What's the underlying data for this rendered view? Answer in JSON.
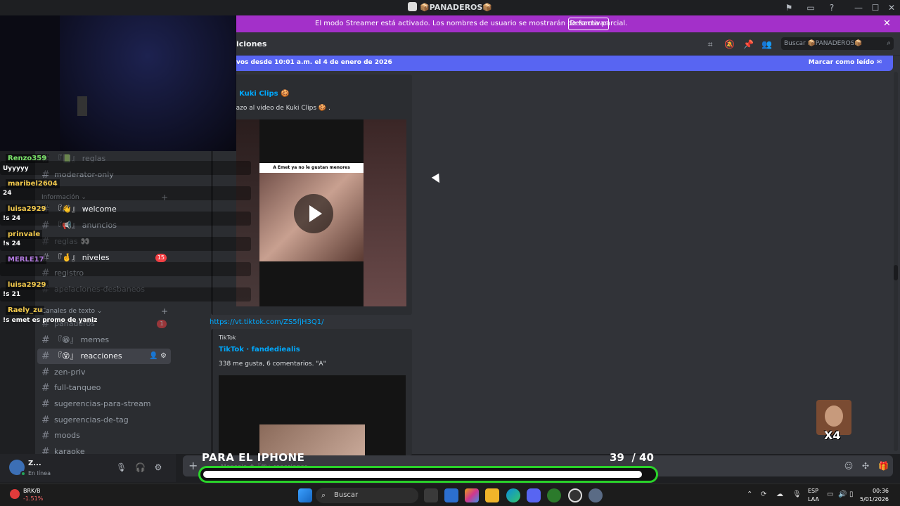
{
  "titlebar": {
    "title": "📦PANADEROS📦"
  },
  "banner": {
    "text": "El modo Streamer está activado. Los nombres de usuario se mostrarán de forma parcial.",
    "button": "Desactivar"
  },
  "header": {
    "channel": "iciones",
    "search_placeholder": "Buscar 📦PANADEROS📦"
  },
  "new_messages": {
    "text": "vos desde 10:01 a.m. el 4 de enero de 2026",
    "mark_read": "Marcar como leído"
  },
  "sidebar": {
    "channels": [
      {
        "label": "reglas",
        "prefix": "『📗』",
        "state": "muted"
      },
      {
        "label": "moderator-only",
        "prefix": "",
        "state": "normal"
      },
      {
        "label": "welcome",
        "prefix": "『👋』",
        "state": "unread"
      },
      {
        "label": "anuncios",
        "prefix": "『📢』",
        "state": "normal"
      },
      {
        "label": "reglas 👀",
        "prefix": "",
        "state": "muted"
      },
      {
        "label": "niveles",
        "prefix": "『🤞』",
        "state": "unread",
        "badge": "15"
      },
      {
        "label": "registro",
        "prefix": "",
        "state": "normal"
      },
      {
        "label": "apelaciones-desbaneos",
        "prefix": "",
        "state": "muted"
      },
      {
        "label": "panaderos",
        "prefix": "",
        "state": "muted",
        "badge": "1"
      },
      {
        "label": "memes",
        "prefix": "『😁』",
        "state": "normal"
      },
      {
        "label": "reacciones",
        "prefix": "『😵』",
        "state": "active"
      },
      {
        "label": "zen-priv",
        "prefix": "",
        "state": "normal"
      },
      {
        "label": "full-tanqueo",
        "prefix": "",
        "state": "normal"
      },
      {
        "label": "sugerencias-para-stream",
        "prefix": "",
        "state": "normal"
      },
      {
        "label": "sugerencias-de-tag",
        "prefix": "",
        "state": "normal"
      },
      {
        "label": "moods",
        "prefix": "",
        "state": "normal"
      },
      {
        "label": "karaoke",
        "prefix": "",
        "state": "normal"
      }
    ],
    "categories": {
      "info": "Información",
      "text": "Canales de texto"
    }
  },
  "user": {
    "name": "Z...",
    "status": "En línea"
  },
  "messages": {
    "embed1": {
      "title": "tok · Kuki Clips 🍪",
      "desc": "n vistazo al video de Kuki Clips 🍪 .",
      "thumb_caption": "A Emet ya no le gustan menores"
    },
    "link": "https://vt.tiktok.com/ZS5fjH3Q1/",
    "embed2": {
      "provider": "TikTok",
      "title": "TikTok · fandediealis",
      "desc": "338 me gusta, 6 comentarios. \"A\""
    }
  },
  "composer": {
    "placeholder": "Mensaje #『😵』reacciones"
  },
  "overlay": {
    "chat": [
      {
        "user": "Renzo359",
        "msg": "Uyyyyy",
        "color": "#7be36a"
      },
      {
        "user": "maribel2604",
        "msg": "24",
        "color": "#f2c94c"
      },
      {
        "user": "luisa2929",
        "msg": "!s 24",
        "color": "#f2c94c"
      },
      {
        "user": "prinvale",
        "msg": "!s 24",
        "color": "#f2c94c"
      },
      {
        "user": "MERLE17",
        "msg": "",
        "color": "#b57be3"
      },
      {
        "user": "luisa2929",
        "msg": "!s 21",
        "color": "#f2c94c"
      },
      {
        "user": "Raely_zu",
        "msg": "!s emet es promo de yaniz",
        "color": "#f2c94c"
      }
    ],
    "goal_label": "PARA EL IPHONE",
    "goal_current": "39",
    "goal_total": "/ 40",
    "goal_progress": 0.975,
    "emote_text": "X4"
  },
  "taskbar": {
    "stock_name": "BRK/B",
    "stock_change": "-1.51%",
    "search": "Buscar",
    "lang1": "ESP",
    "lang2": "LAA",
    "time": "00:36",
    "date": "5/01/2026"
  },
  "colors": {
    "banner": "#a330c9",
    "accent": "#5865f2",
    "goal_border": "#2ad32a"
  }
}
